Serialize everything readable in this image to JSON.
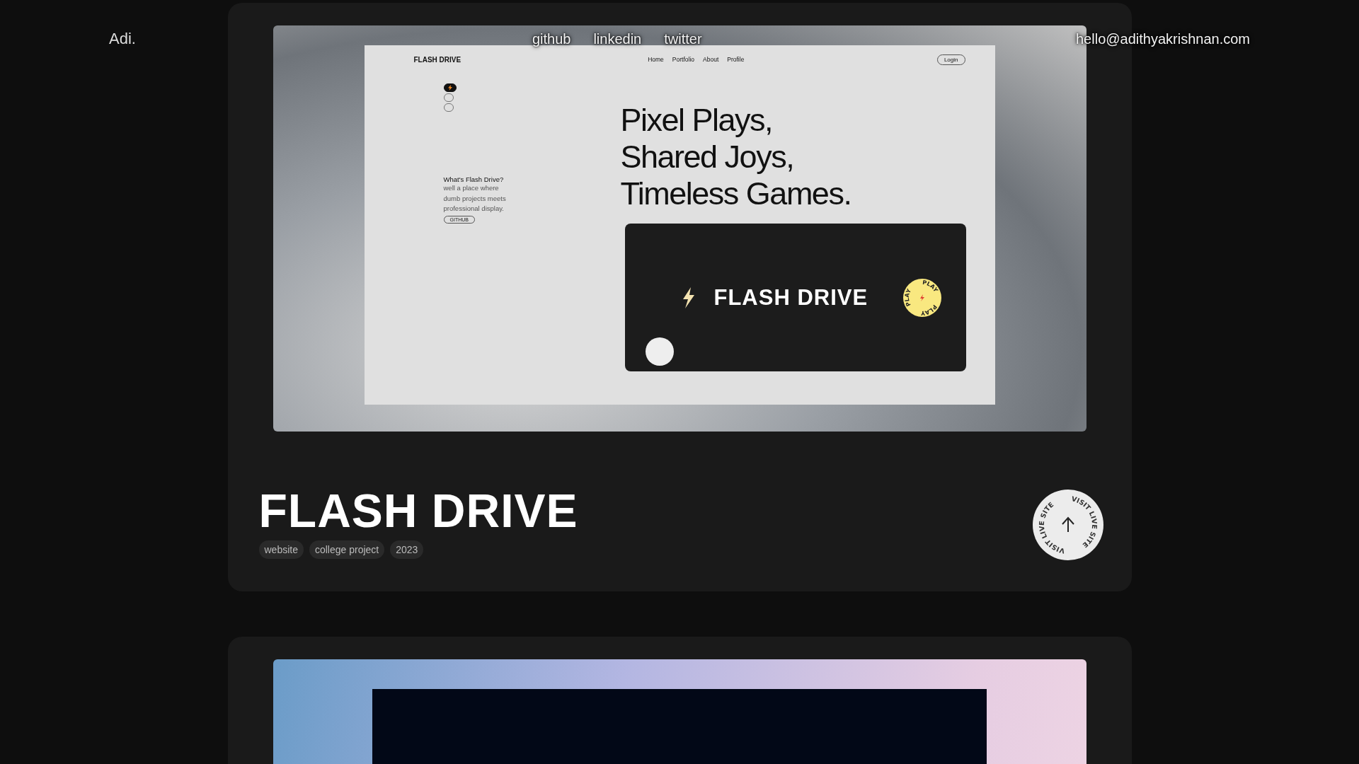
{
  "header": {
    "logo": "Adi.",
    "nav": [
      "github",
      "linkedin",
      "twitter"
    ],
    "email": "hello@adithyakrishnan.com"
  },
  "projects": [
    {
      "title": "FLASH DRIVE",
      "tags": [
        "website",
        "college project",
        "2023"
      ],
      "badge": {
        "ring_text": [
          "VISIT LIVE SITE",
          "VISIT LIVE SITE"
        ]
      },
      "preview": {
        "kind": "site",
        "site": {
          "logo": "FLASH DRIVE",
          "nav": [
            "Home",
            "Portfolio",
            "About",
            "Profile"
          ],
          "login": "Login",
          "slides": [
            {
              "selected": true
            },
            {
              "selected": false
            },
            {
              "selected": false
            }
          ],
          "intro_title": "What's Flash Drive?",
          "intro_text": "well a place where dumb projects meets professional display.",
          "github": "GITHUB",
          "headline": [
            "Pixel Plays,",
            "Shared Joys,",
            "Timeless Games."
          ],
          "banner_title": "FLASH DRIVE",
          "play_ring": [
            "PLAY",
            "PLAY",
            "PLAY"
          ]
        }
      }
    },
    {
      "preview": {
        "kind": "dark"
      }
    }
  ]
}
